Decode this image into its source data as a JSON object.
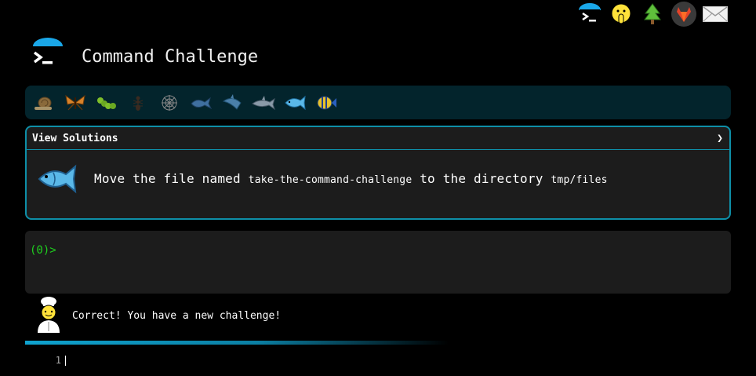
{
  "header": {
    "title": "Command Challenge",
    "top_icons": [
      "terminal-logo-icon",
      "emoji-shush-icon",
      "tree-icon",
      "gitlab-icon",
      "mail-icon"
    ]
  },
  "levels": [
    "snail",
    "butterfly",
    "caterpillar",
    "ant",
    "spider-web",
    "whale",
    "shark",
    "dolphin",
    "fish",
    "tropical-fish"
  ],
  "challenge": {
    "view_solutions": "View Solutions",
    "chevron": "❯",
    "text_1": "Move the file named",
    "file": "take-the-command-challenge",
    "text_2": "to the directory",
    "dir": "tmp/files"
  },
  "terminal": {
    "prompt": "(0)>"
  },
  "feedback": {
    "message": "Correct! You have a new challenge!"
  },
  "progress": {
    "fraction": 0.6
  },
  "editor": {
    "line_number": "1"
  },
  "colors": {
    "accent": "#0e8fa8",
    "prompt": "#1ed01e",
    "panel": "#1c1c1c",
    "level_bar": "#03242c"
  }
}
